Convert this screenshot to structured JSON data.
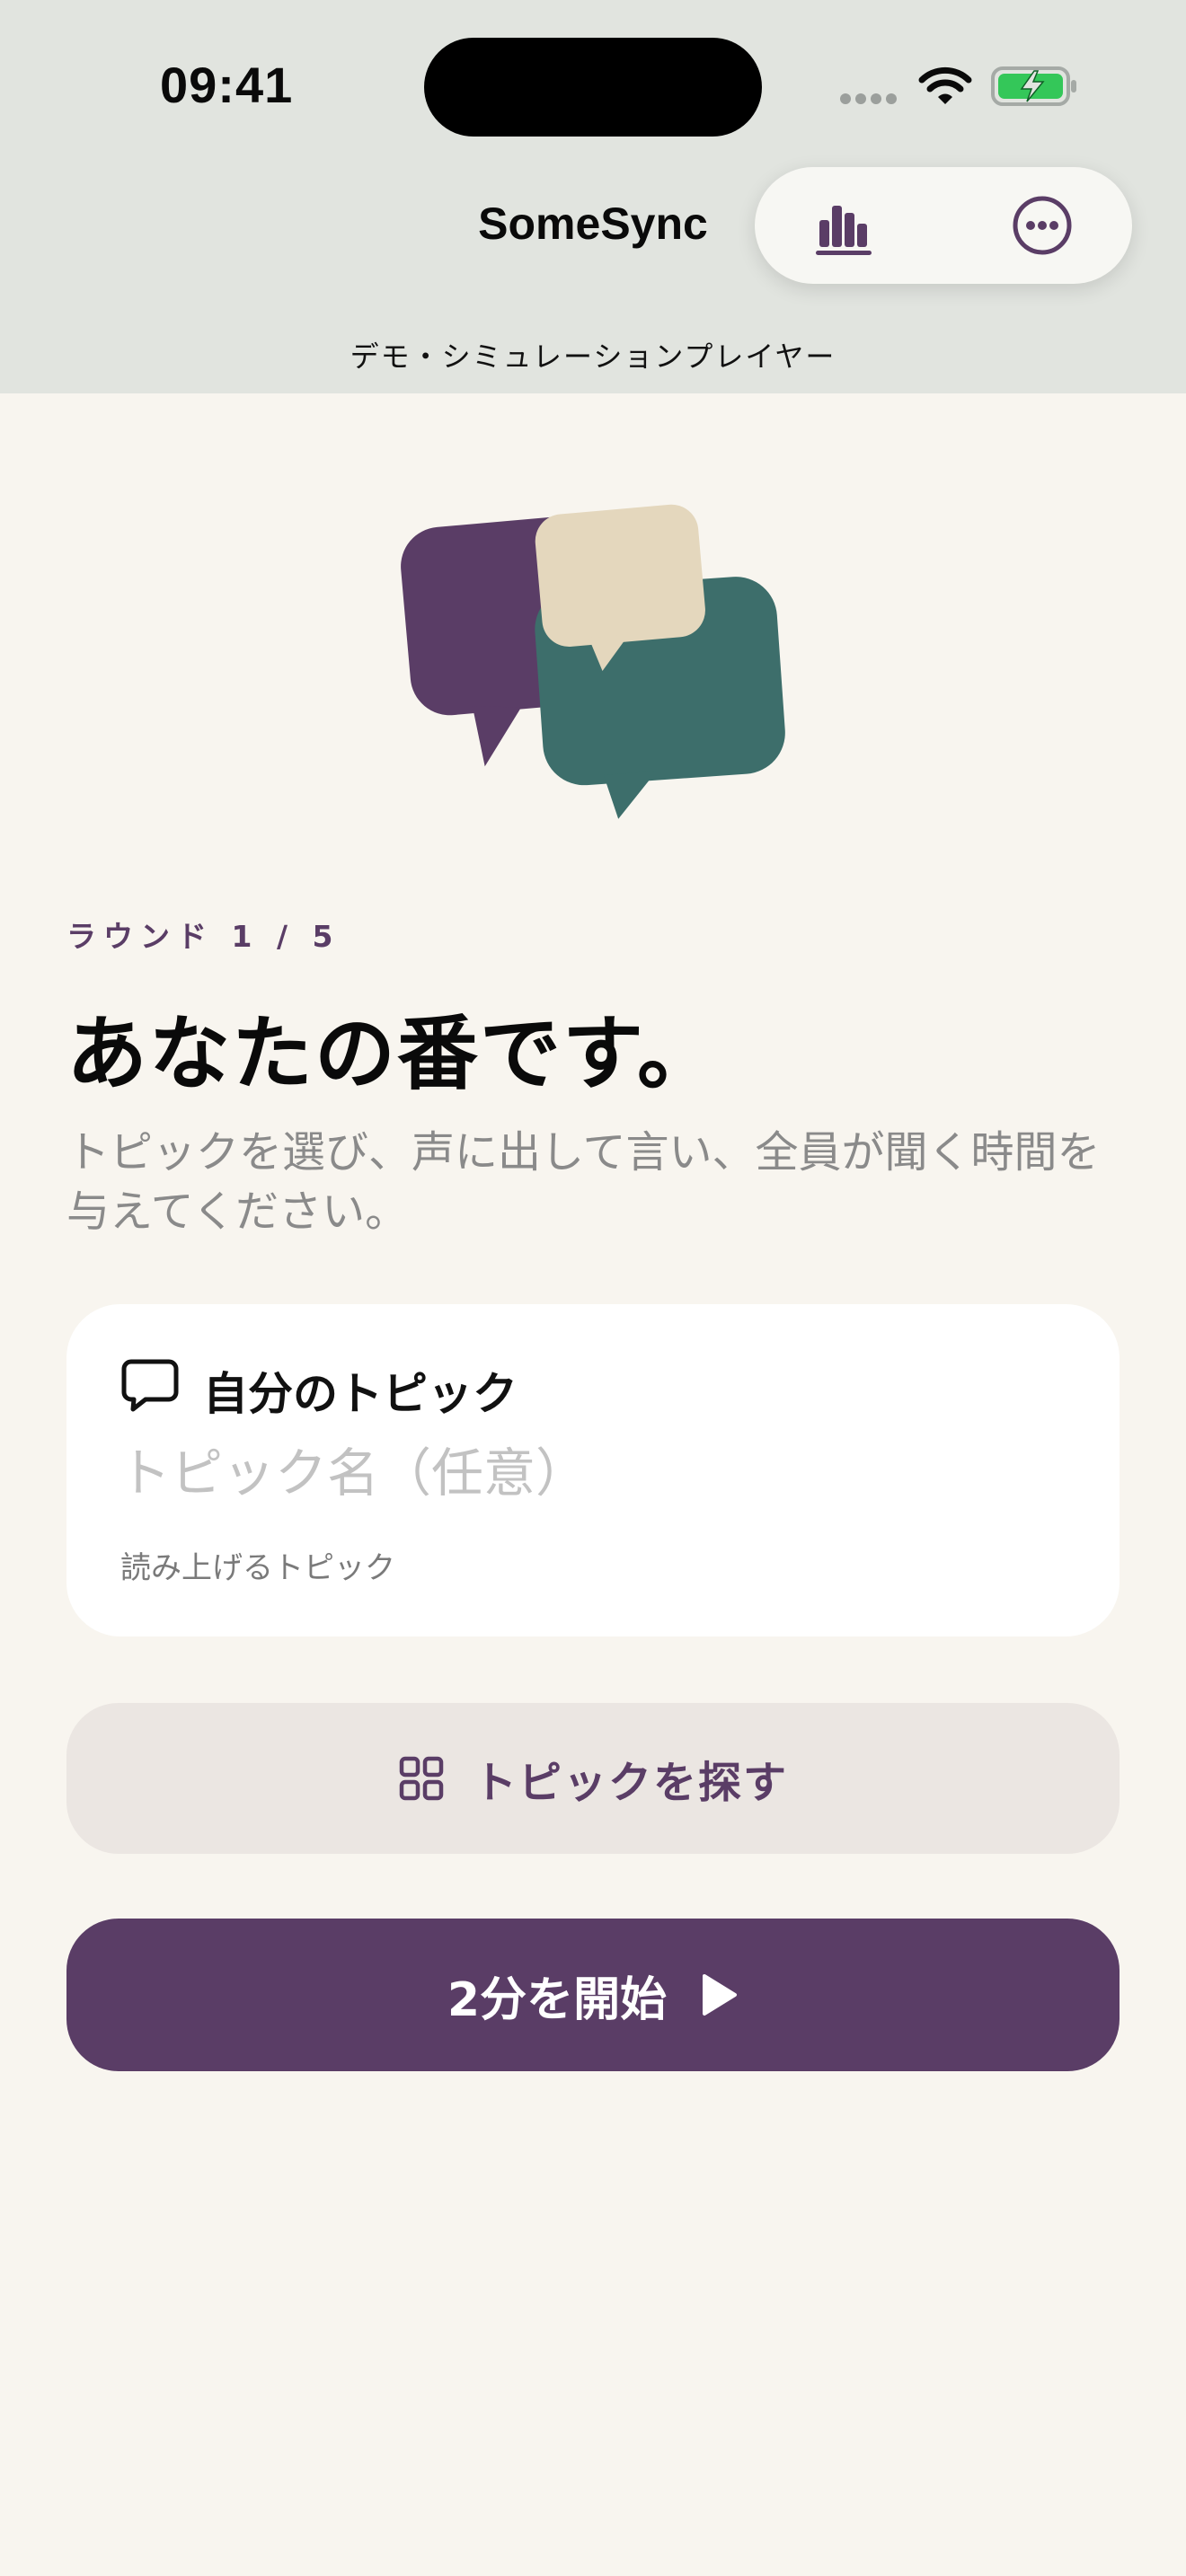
{
  "status_bar": {
    "time": "09:41",
    "icons": [
      "cellular-icon",
      "wifi-icon",
      "battery-charging-icon"
    ]
  },
  "header": {
    "app_title": "SomeSync",
    "subtitle": "デモ・シミュレーションプレイヤー",
    "toolbar": [
      "stats-chart-icon",
      "more-options-icon"
    ]
  },
  "main": {
    "round_label": "ラウンド 1 / 5",
    "title": "あなたの番です。",
    "description": "トピックを選び、声に出して言い、全員が聞く時間を与えてください。"
  },
  "topic_card": {
    "label": "自分のトピック",
    "input_value": "",
    "input_placeholder": "トピック名（任意）",
    "helper": "読み上げるトピック"
  },
  "browse_button": {
    "label": "トピックを探す"
  },
  "start_button": {
    "label": "2分を開始"
  },
  "colors": {
    "header_bg": "#e1e4df",
    "page_bg": "#f8f5ef",
    "accent_purple": "#5a3d66",
    "bubble_green": "#3d6e6b",
    "bubble_beige": "#e4d7bd",
    "battery_green": "#34c759"
  }
}
